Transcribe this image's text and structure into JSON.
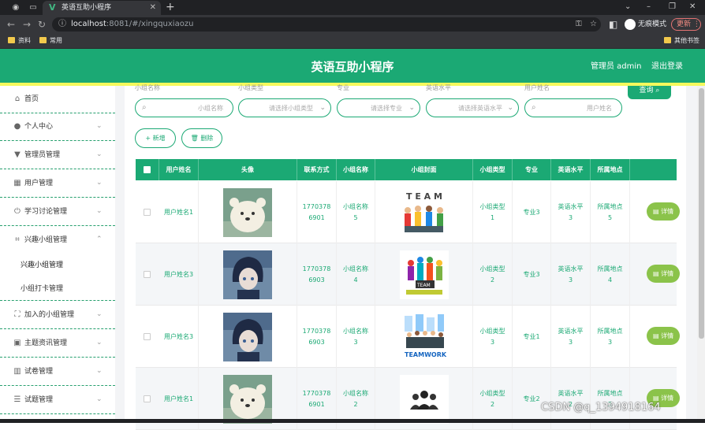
{
  "browser": {
    "tab_title": "英语互助小程序",
    "url_host": "localhost",
    "url_path": ":8081/#/xingquxiaozu",
    "incognito_label": "无痕模式",
    "update_label": "更新",
    "bookmarks": [
      "资料",
      "常用"
    ],
    "other_bookmarks": "其他书签"
  },
  "header": {
    "title": "英语互助小程序",
    "admin": "管理员 admin",
    "logout": "退出登录",
    "accent": "#1ba974",
    "stripe": "#f5f95c"
  },
  "sidebar": {
    "items": [
      {
        "label": "首页",
        "icon": "home-icon"
      },
      {
        "label": "个人中心",
        "icon": "user-icon"
      },
      {
        "label": "管理员管理",
        "icon": "admin-icon"
      },
      {
        "label": "用户管理",
        "icon": "grid-icon"
      },
      {
        "label": "学习讨论管理",
        "icon": "power-icon"
      },
      {
        "label": "兴趣小组管理",
        "icon": "crop-icon"
      },
      {
        "label": "加入的小组管理",
        "icon": "fullscreen-icon"
      },
      {
        "label": "主题资讯管理",
        "icon": "clipboard-icon"
      },
      {
        "label": "试卷管理",
        "icon": "chart-icon"
      },
      {
        "label": "试题管理",
        "icon": "sliders-icon"
      }
    ],
    "subitems": [
      "兴趣小组管理",
      "小组打卡管理"
    ]
  },
  "search": {
    "labels": [
      "小组名称",
      "小组类型",
      "专业",
      "英语水平",
      "用户姓名"
    ],
    "placeholders": [
      "小组名称",
      "请选择小组类型",
      "请选择专业",
      "请选择英语水平",
      "用户姓名"
    ],
    "query_label": "查询"
  },
  "actions": {
    "add": "新增",
    "delete": "删除"
  },
  "table": {
    "headers": [
      "用户姓名",
      "头像",
      "联系方式",
      "小组名称",
      "小组封面",
      "小组类型",
      "专业",
      "英语水平",
      "所属地点"
    ],
    "detail_label": "详情",
    "rows": [
      {
        "user": "用户姓名1",
        "avatar": "bear",
        "phone": "17703786901",
        "group": "小组名称5",
        "cover": "team-people",
        "type": "小组类型1",
        "major": "专业3",
        "level": "英语水平3",
        "place": "所属地点5"
      },
      {
        "user": "用户姓名3",
        "avatar": "anime-boy",
        "phone": "17703786903",
        "group": "小组名称4",
        "cover": "teamwork-puzzle",
        "type": "小组类型2",
        "major": "专业3",
        "level": "英语水平3",
        "place": "所属地点4"
      },
      {
        "user": "用户姓名3",
        "avatar": "anime-boy",
        "phone": "17703786903",
        "group": "小组名称3",
        "cover": "teamwork-business",
        "type": "小组类型3",
        "major": "专业1",
        "level": "英语水平3",
        "place": "所属地点3"
      },
      {
        "user": "用户姓名1",
        "avatar": "bear",
        "phone": "17703786901",
        "group": "小组名称2",
        "cover": "group-silhouette",
        "type": "小组类型2",
        "major": "专业2",
        "level": "英语水平2",
        "place": "所属地点2"
      }
    ]
  },
  "watermark": "CSDN @q_1394918164"
}
